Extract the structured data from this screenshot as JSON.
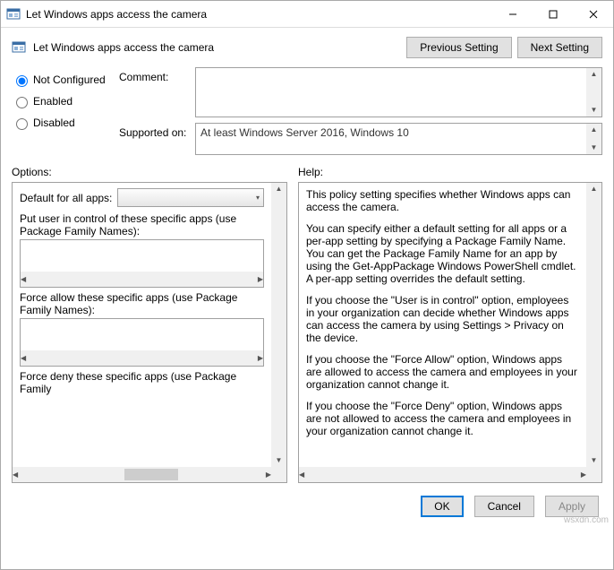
{
  "window": {
    "title": "Let Windows apps access the camera"
  },
  "header": {
    "label": "Let Windows apps access the camera"
  },
  "nav": {
    "prev": "Previous Setting",
    "next": "Next Setting"
  },
  "radios": {
    "not_configured": "Not Configured",
    "enabled": "Enabled",
    "disabled": "Disabled",
    "selected": "not_configured"
  },
  "fields": {
    "comment_label": "Comment:",
    "comment_value": "",
    "supported_label": "Supported on:",
    "supported_value": "At least Windows Server 2016, Windows 10"
  },
  "labels": {
    "options": "Options:",
    "help": "Help:"
  },
  "options": {
    "default_label": "Default for all apps:",
    "default_value": "",
    "user_control_label": "Put user in control of these specific apps (use Package Family Names):",
    "force_allow_label": "Force allow these specific apps (use Package Family Names):",
    "force_deny_label": "Force deny these specific apps (use Package Family"
  },
  "help": {
    "p1": "This policy setting specifies whether Windows apps can access the camera.",
    "p2": "You can specify either a default setting for all apps or a per-app setting by specifying a Package Family Name. You can get the Package Family Name for an app by using the Get-AppPackage Windows PowerShell cmdlet. A per-app setting overrides the default setting.",
    "p3": "If you choose the \"User is in control\" option, employees in your organization can decide whether Windows apps can access the camera by using Settings > Privacy on the device.",
    "p4": "If you choose the \"Force Allow\" option, Windows apps are allowed to access the camera and employees in your organization cannot change it.",
    "p5": "If you choose the \"Force Deny\" option, Windows apps are not allowed to access the camera and employees in your organization cannot change it."
  },
  "footer": {
    "ok": "OK",
    "cancel": "Cancel",
    "apply": "Apply"
  },
  "watermark": "wsxdn.com"
}
